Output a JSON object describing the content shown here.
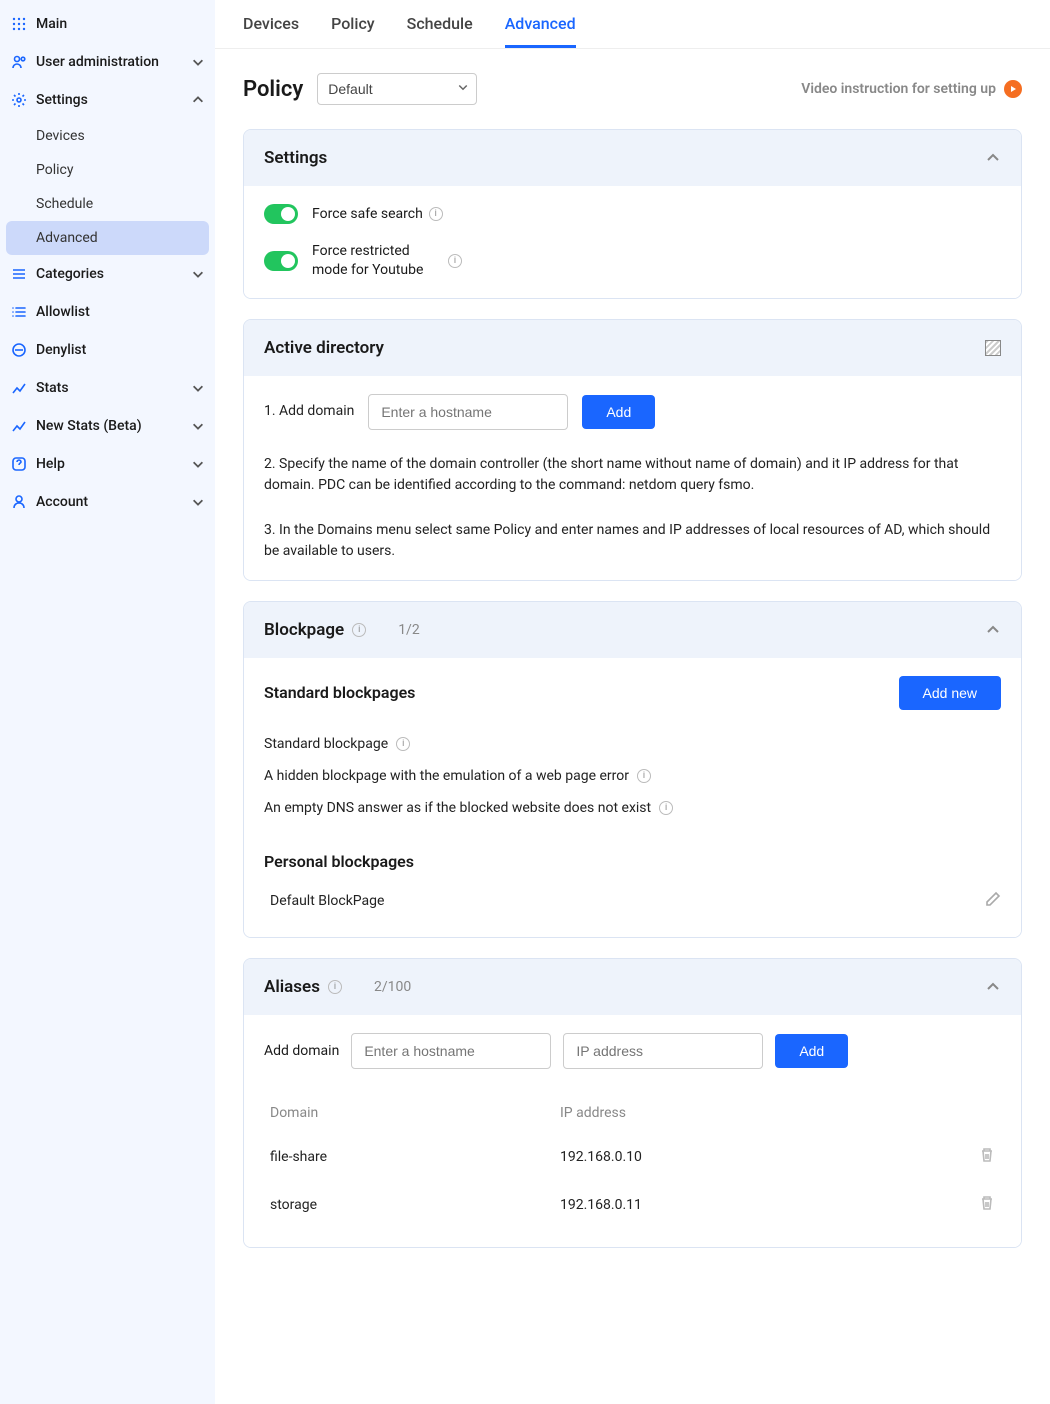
{
  "sidebar": {
    "main": "Main",
    "user_admin": "User administration",
    "settings": "Settings",
    "settings_children": [
      "Devices",
      "Policy",
      "Schedule",
      "Advanced"
    ],
    "categories": "Categories",
    "allowlist": "Allowlist",
    "denylist": "Denylist",
    "stats": "Stats",
    "new_stats": "New Stats (Beta)",
    "help": "Help",
    "account": "Account"
  },
  "tabs": [
    "Devices",
    "Policy",
    "Schedule",
    "Advanced"
  ],
  "active_tab": "Advanced",
  "policy": {
    "label": "Policy",
    "selected": "Default"
  },
  "video_link": "Video instruction for setting up",
  "settings_panel": {
    "title": "Settings",
    "toggle1": "Force safe search",
    "toggle2": "Force restricted mode for Youtube"
  },
  "ad_panel": {
    "title": "Active directory",
    "step1_label": "1. Add domain",
    "step1_placeholder": "Enter a hostname",
    "step1_btn": "Add",
    "step2": "2. Specify the name of the domain controller (the short name without name of domain) and it IP address for that domain. PDC can be identified according to the command: netdom query fsmo.",
    "step3": "3. In the Domains menu select same Policy and enter names and IP addresses of local resources of AD, which should be available to users."
  },
  "bp_panel": {
    "title": "Blockpage",
    "count": "1/2",
    "standard_header": "Standard blockpages",
    "addnew": "Add new",
    "rows": [
      "Standard blockpage",
      "A hidden blockpage with the emulation of a web page error",
      "An empty DNS answer as if the blocked website does not exist"
    ],
    "personal_header": "Personal blockpages",
    "personal_row": "Default BlockPage"
  },
  "alias_panel": {
    "title": "Aliases",
    "count": "2/100",
    "add_label": "Add domain",
    "host_placeholder": "Enter a hostname",
    "ip_placeholder": "IP address",
    "add_btn": "Add",
    "head_domain": "Domain",
    "head_ip": "IP address",
    "rows": [
      {
        "domain": "file-share",
        "ip": "192.168.0.10"
      },
      {
        "domain": "storage",
        "ip": "192.168.0.11"
      }
    ]
  }
}
